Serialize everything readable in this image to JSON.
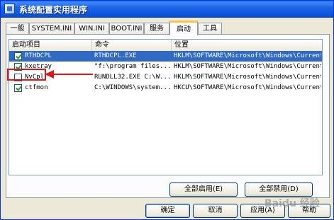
{
  "window": {
    "title": "系统配置实用程序"
  },
  "tabs": [
    {
      "label": "一般"
    },
    {
      "label": "SYSTEM.INI"
    },
    {
      "label": "WIN.INI"
    },
    {
      "label": "BOOT.INI"
    },
    {
      "label": "服务"
    },
    {
      "label": "启动",
      "active": true
    },
    {
      "label": "工具"
    }
  ],
  "startup": {
    "columns": [
      "启动项目",
      "命令",
      "位置"
    ],
    "rows": [
      {
        "item": "RTHDCPL",
        "command": "RTHDCPL.EXE",
        "location": "HKLM\\SOFTWARE\\Microsoft\\Windows\\Current...",
        "checked": true,
        "selected": true
      },
      {
        "item": "kxetray",
        "command": "\"f:\\program files...",
        "location": "HKLM\\SOFTWARE\\Microsoft\\Windows\\Current...",
        "checked": true,
        "selected": false
      },
      {
        "item": "NvCpl",
        "command": "RUNDLL32.EXE C:\\W...",
        "location": "HKLM\\SOFTWARE\\Microsoft\\Windows\\Current...",
        "checked": false,
        "selected": false
      },
      {
        "item": "ctfmon",
        "command": "C:\\WINDOWS\\system...",
        "location": "HKCU\\SOFTWARE\\Microsoft\\Windows\\Current...",
        "checked": true,
        "selected": false
      }
    ]
  },
  "buttons": {
    "enable_all": "全部启用(E)",
    "disable_all": "全部禁用(D)",
    "ok": "确定",
    "cancel": "取消",
    "apply": "应用(A)",
    "help": "帮助"
  },
  "watermark": "Baidu 经验",
  "colors": {
    "selection": "#316ac5",
    "annotation": "#d8181f",
    "titlebar": "#0a52d9"
  }
}
